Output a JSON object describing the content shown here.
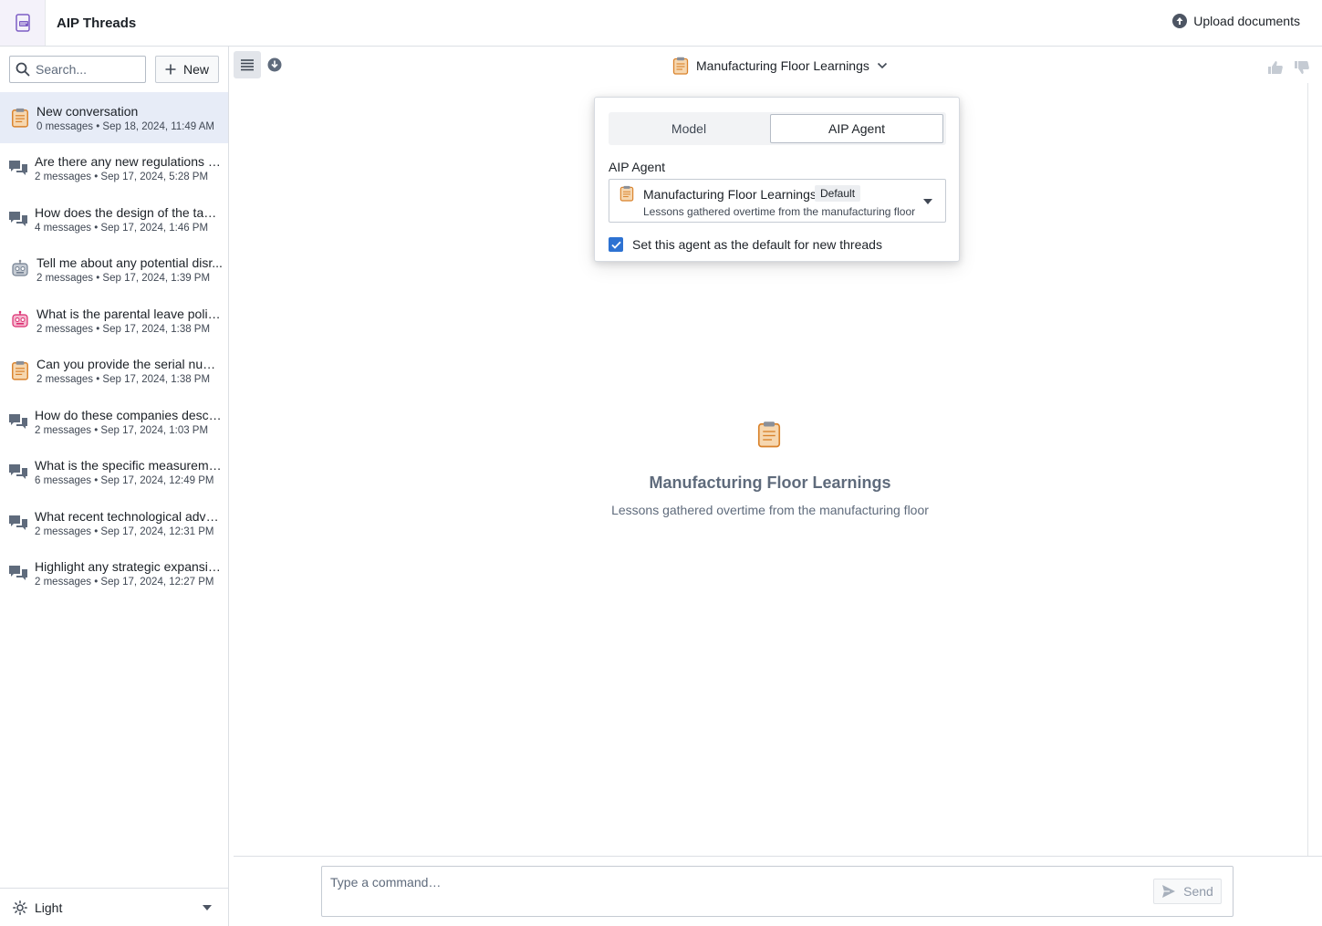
{
  "app": {
    "title": "AIP Threads"
  },
  "header": {
    "upload_label": "Upload documents"
  },
  "sidebar": {
    "search_placeholder": "Search...",
    "new_label": "New",
    "threads": [
      {
        "title": "New conversation",
        "meta": "0 messages • Sep 18, 2024, 11:49 AM",
        "icon": "clipboard-icon",
        "active": true
      },
      {
        "title": "Are there any new regulations ap...",
        "meta": "2 messages • Sep 17, 2024, 5:28 PM",
        "icon": "chat-bubbles-icon"
      },
      {
        "title": "How does the design of the taper ...",
        "meta": "4 messages • Sep 17, 2024, 1:46 PM",
        "icon": "chat-bubbles-icon"
      },
      {
        "title": "Tell me about any potential disr...",
        "meta": "2 messages • Sep 17, 2024, 1:39 PM",
        "icon": "robot-gray-icon"
      },
      {
        "title": "What is the parental leave policy?",
        "meta": "2 messages • Sep 17, 2024, 1:38 PM",
        "icon": "robot-pink-icon"
      },
      {
        "title": "Can you provide the serial numb...",
        "meta": "2 messages • Sep 17, 2024, 1:38 PM",
        "icon": "clipboard-icon"
      },
      {
        "title": "How do these companies describ...",
        "meta": "2 messages • Sep 17, 2024, 1:03 PM",
        "icon": "chat-bubbles-icon"
      },
      {
        "title": "What is the specific measuremen...",
        "meta": "6 messages • Sep 17, 2024, 12:49 PM",
        "icon": "chat-bubbles-icon"
      },
      {
        "title": "What recent technological advan...",
        "meta": "2 messages • Sep 17, 2024, 12:31 PM",
        "icon": "chat-bubbles-icon"
      },
      {
        "title": "Highlight any strategic expansion...",
        "meta": "2 messages • Sep 17, 2024, 12:27 PM",
        "icon": "chat-bubbles-icon"
      }
    ],
    "theme_label": "Light"
  },
  "main": {
    "agent_title": "Manufacturing Floor Learnings",
    "popover": {
      "tab_model": "Model",
      "tab_agent": "AIP Agent",
      "selected_tab": "AIP Agent",
      "field_label": "AIP Agent",
      "agent_name": "Manufacturing Floor Learnings",
      "agent_badge": "Default",
      "agent_desc": "Lessons gathered overtime from the manufacturing floor",
      "checkbox_label": "Set this agent as the default for new threads",
      "checkbox_checked": true
    },
    "empty_state": {
      "title": "Manufacturing Floor Learnings",
      "description": "Lessons gathered overtime from the manufacturing floor"
    },
    "composer": {
      "placeholder": "Type a command…",
      "send_label": "Send"
    }
  },
  "colors": {
    "accent": "#2d72d2",
    "active_thread_bg": "#e7ecf7",
    "clipboard_orange": "#d9822b",
    "robot_pink": "#db2c6f"
  }
}
